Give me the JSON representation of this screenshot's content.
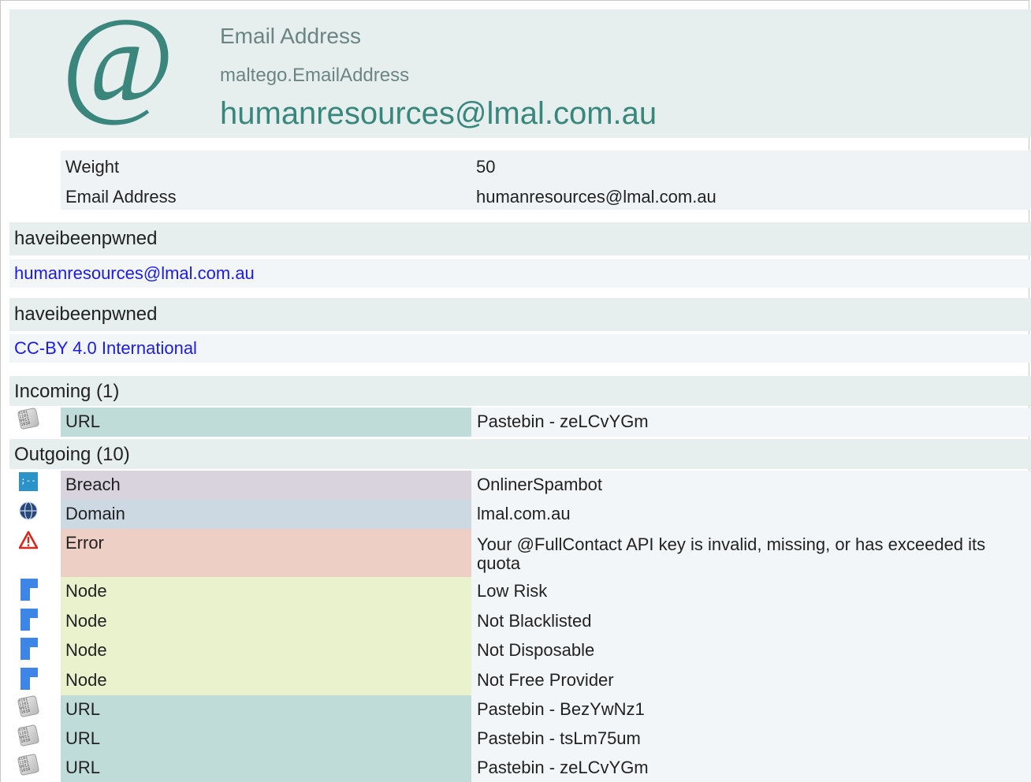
{
  "header": {
    "icon": "at-sign-icon",
    "entity_type": "Email Address",
    "entity_id": "maltego.EmailAddress",
    "entity_value": "humanresources@lmal.com.au"
  },
  "properties": [
    {
      "key": "Weight",
      "value": "50"
    },
    {
      "key": "Email Address",
      "value": "humanresources@lmal.com.au"
    }
  ],
  "sections": [
    {
      "title": "haveibeenpwned",
      "link": "humanresources@lmal.com.au"
    },
    {
      "title": "haveibeenpwned",
      "link": "CC-BY 4.0 International"
    }
  ],
  "incoming": {
    "title": "Incoming (1)",
    "rows": [
      {
        "icon": "binary-document-icon",
        "type": "URL",
        "value": "Pastebin - zeLCvYGm"
      }
    ]
  },
  "outgoing": {
    "title": "Outgoing (10)",
    "rows": [
      {
        "icon": "breach-icon",
        "type": "Breach",
        "value": "OnlinerSpambot"
      },
      {
        "icon": "globe-icon",
        "type": "Domain",
        "value": "lmal.com.au"
      },
      {
        "icon": "warning-icon",
        "type": "Error",
        "value": "Your @FullContact API key is invalid, missing, or has exceeded its quota"
      },
      {
        "icon": "node-icon",
        "type": "Node",
        "value": "Low Risk"
      },
      {
        "icon": "node-icon",
        "type": "Node",
        "value": "Not Blacklisted"
      },
      {
        "icon": "node-icon",
        "type": "Node",
        "value": "Not Disposable"
      },
      {
        "icon": "node-icon",
        "type": "Node",
        "value": "Not Free Provider"
      },
      {
        "icon": "binary-document-icon",
        "type": "URL",
        "value": "Pastebin - BezYwNz1"
      },
      {
        "icon": "binary-document-icon",
        "type": "URL",
        "value": "Pastebin - tsLm75um"
      },
      {
        "icon": "binary-document-icon",
        "type": "URL",
        "value": "Pastebin - zeLCvYGm"
      }
    ]
  },
  "colors": {
    "accent": "#37877d",
    "link": "#1a1aee",
    "url_bg": "#c0dcd8",
    "breach_bg": "#d8d3dd",
    "domain_bg": "#ccd8e2",
    "error_bg": "#eecfc6",
    "node_bg": "#e9f1cd"
  }
}
